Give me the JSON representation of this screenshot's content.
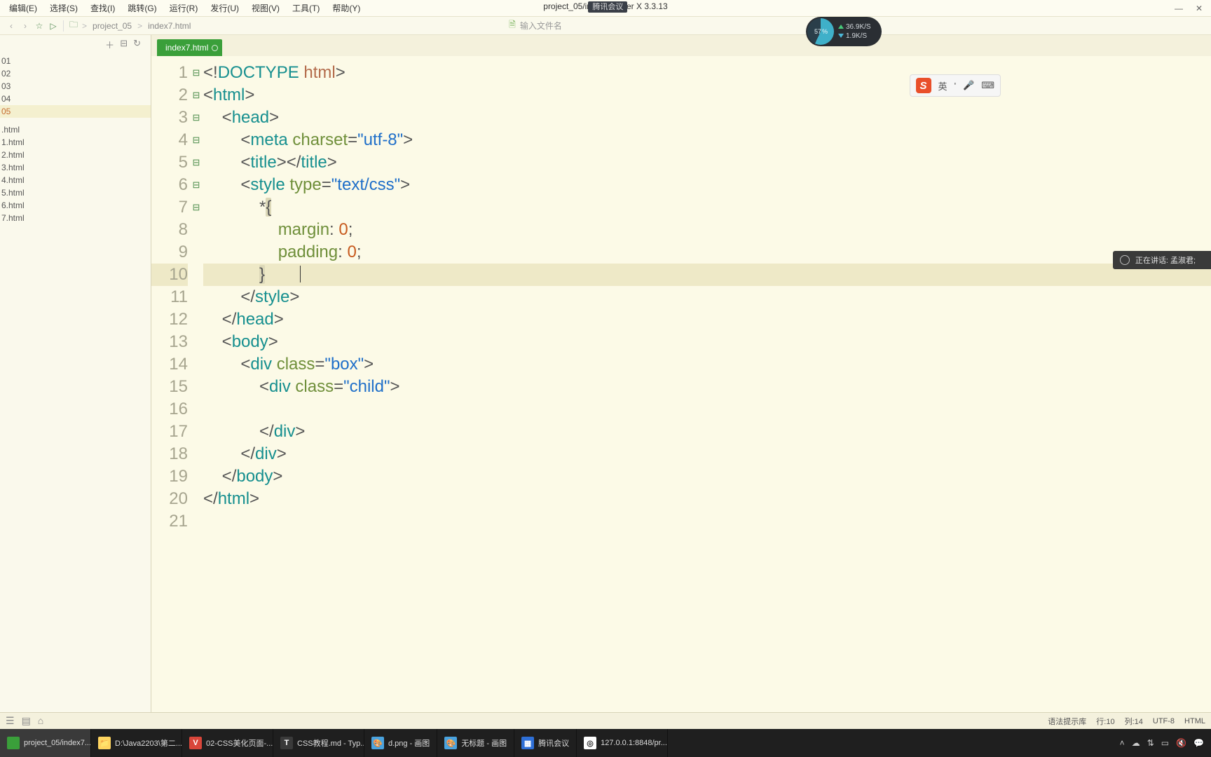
{
  "window_title_left": "project_05/inde...",
  "window_title_right": "Builder X 3.3.13",
  "title_overlay": "腾讯会议",
  "menu": [
    "编辑(E)",
    "选择(S)",
    "查找(I)",
    "跳转(G)",
    "运行(R)",
    "发行(U)",
    "视图(V)",
    "工具(T)",
    "帮助(Y)"
  ],
  "breadcrumb": [
    "project_05",
    "index7.html"
  ],
  "center_input_placeholder": "输入文件名",
  "tab_active": "index7.html",
  "sidebar_top_items": [
    "01",
    "02",
    "03",
    "04",
    "05"
  ],
  "sidebar_bottom_items": [
    ".html",
    "1.html",
    "2.html",
    "3.html",
    "4.html",
    "5.html",
    "6.html",
    "7.html"
  ],
  "code": {
    "1": {
      "ind": "",
      "html": "<span class='t-punct'>&lt;!</span><span class='t-tag'>DOCTYPE</span> <span class='t-kw'>html</span><span class='t-punct'>&gt;</span>"
    },
    "2": {
      "ind": "",
      "fold": "⊟",
      "html": "<span class='t-punct'>&lt;</span><span class='t-tag'>html</span><span class='t-punct'>&gt;</span>"
    },
    "3": {
      "ind": "    ",
      "fold": "⊟",
      "html": "<span class='t-punct'>&lt;</span><span class='t-tag'>head</span><span class='t-punct'>&gt;</span>"
    },
    "4": {
      "ind": "        ",
      "html": "<span class='t-punct'>&lt;</span><span class='t-tag'>meta</span> <span class='t-attr'>charset</span><span class='t-punct'>=</span><span class='t-str'>\"utf-8\"</span><span class='t-punct'>&gt;</span>"
    },
    "5": {
      "ind": "        ",
      "html": "<span class='t-punct'>&lt;</span><span class='t-tag'>title</span><span class='t-punct'>&gt;&lt;/</span><span class='t-tag'>title</span><span class='t-punct'>&gt;</span>"
    },
    "6": {
      "ind": "        ",
      "fold": "⊟",
      "html": "<span class='t-punct'>&lt;</span><span class='t-tag'>style</span> <span class='t-attr'>type</span><span class='t-punct'>=</span><span class='t-str'>\"text/css\"</span><span class='t-punct'>&gt;</span>"
    },
    "7": {
      "ind": "            ",
      "fold": "⊟",
      "html": "<span class='t-punct'>*</span><span class='t-brace'>{</span>"
    },
    "8": {
      "ind": "                ",
      "html": "<span class='t-attr'>margin</span><span class='t-punct'>:</span> <span class='t-num'>0</span><span class='t-punct'>;</span>"
    },
    "9": {
      "ind": "                ",
      "html": "<span class='t-attr'>padding</span><span class='t-punct'>:</span> <span class='t-num'>0</span><span class='t-punct'>;</span>"
    },
    "10": {
      "ind": "            ",
      "hl": true,
      "html": "<span class='t-brace'>}</span><span class='cursor'></span>"
    },
    "11": {
      "ind": "        ",
      "html": "<span class='t-punct'>&lt;/</span><span class='t-tag'>style</span><span class='t-punct'>&gt;</span>"
    },
    "12": {
      "ind": "    ",
      "html": "<span class='t-punct'>&lt;/</span><span class='t-tag'>head</span><span class='t-punct'>&gt;</span>"
    },
    "13": {
      "ind": "    ",
      "fold": "⊟",
      "html": "<span class='t-punct'>&lt;</span><span class='t-tag'>body</span><span class='t-punct'>&gt;</span>"
    },
    "14": {
      "ind": "        ",
      "fold": "⊟",
      "html": "<span class='t-punct'>&lt;</span><span class='t-tag'>div</span> <span class='t-attr'>class</span><span class='t-punct'>=</span><span class='t-str'>\"box\"</span><span class='t-punct'>&gt;</span>"
    },
    "15": {
      "ind": "            ",
      "fold": "⊟",
      "html": "<span class='t-punct'>&lt;</span><span class='t-tag'>div</span> <span class='t-attr'>class</span><span class='t-punct'>=</span><span class='t-str'>\"child\"</span><span class='t-punct'>&gt;</span>"
    },
    "16": {
      "ind": "                ",
      "html": ""
    },
    "17": {
      "ind": "            ",
      "html": "<span class='t-punct'>&lt;/</span><span class='t-tag'>div</span><span class='t-punct'>&gt;</span>"
    },
    "18": {
      "ind": "        ",
      "html": "<span class='t-punct'>&lt;/</span><span class='t-tag'>div</span><span class='t-punct'>&gt;</span>"
    },
    "19": {
      "ind": "    ",
      "html": "<span class='t-punct'>&lt;/</span><span class='t-tag'>body</span><span class='t-punct'>&gt;</span>"
    },
    "20": {
      "ind": "",
      "html": "<span class='t-punct'>&lt;/</span><span class='t-tag'>html</span><span class='t-punct'>&gt;</span>"
    },
    "21": {
      "ind": "",
      "html": ""
    }
  },
  "speak_label": "正在讲话: 孟淑君;",
  "ime_text": "英",
  "perf": {
    "pct": "57",
    "up": "36.9K/S",
    "dn": "1.9K/S"
  },
  "status": {
    "hint": "语法提示库",
    "line": "行:10",
    "col": "列:14",
    "enc": "UTF-8",
    "lang": "HTML"
  },
  "taskbar": [
    {
      "label": "project_05/index7...",
      "active": true,
      "color": "#3a9f3a",
      "icon": ""
    },
    {
      "label": "D:\\Java2203\\第二...",
      "color": "#ffd560",
      "icon": "📁"
    },
    {
      "label": "02-CSS美化页面-...",
      "color": "#d9463a",
      "icon": "V"
    },
    {
      "label": "CSS教程.md - Typ...",
      "color": "#3a3a3a",
      "icon": "T"
    },
    {
      "label": "d.png - 画图",
      "color": "#4aa3df",
      "icon": "🎨"
    },
    {
      "label": "无标题 - 画图",
      "color": "#4aa3df",
      "icon": "🎨"
    },
    {
      "label": "腾讯会议",
      "color": "#2e6fd6",
      "icon": "▦"
    },
    {
      "label": "127.0.0.1:8848/pr...",
      "color": "#ffffff",
      "icon": "◎"
    }
  ]
}
